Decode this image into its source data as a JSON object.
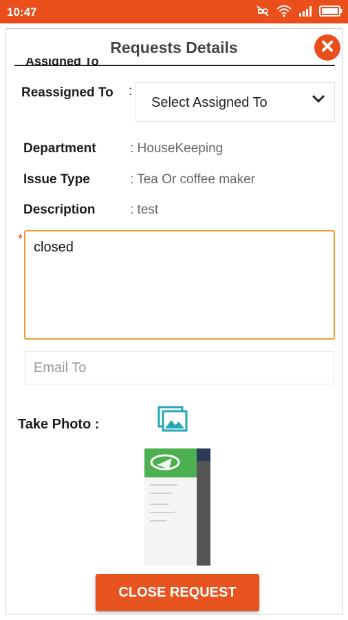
{
  "status_bar": {
    "time": "10:47",
    "icons": [
      "mute-icon",
      "wifi-icon",
      "signal-icon",
      "battery-icon"
    ],
    "color": "#e94e1b"
  },
  "dialog": {
    "title": "Requests Details",
    "partial_label": "Assigned To",
    "close_icon": "close-icon"
  },
  "form": {
    "reassigned_label": "Reassigned To",
    "colon": ":",
    "select_value": "Select Assigned To",
    "fields": [
      {
        "label": "Department",
        "value": ": HouseKeeping"
      },
      {
        "label": "Issue Type",
        "value": ": Tea Or coffee maker"
      },
      {
        "label": "Description",
        "value": ": test"
      }
    ],
    "required_mark": "*",
    "comment_value": "closed",
    "email_placeholder": "Email To",
    "take_photo_label": "Take Photo :"
  },
  "actions": {
    "close_request_label": "CLOSE REQUEST",
    "accent": "#e8541f"
  }
}
